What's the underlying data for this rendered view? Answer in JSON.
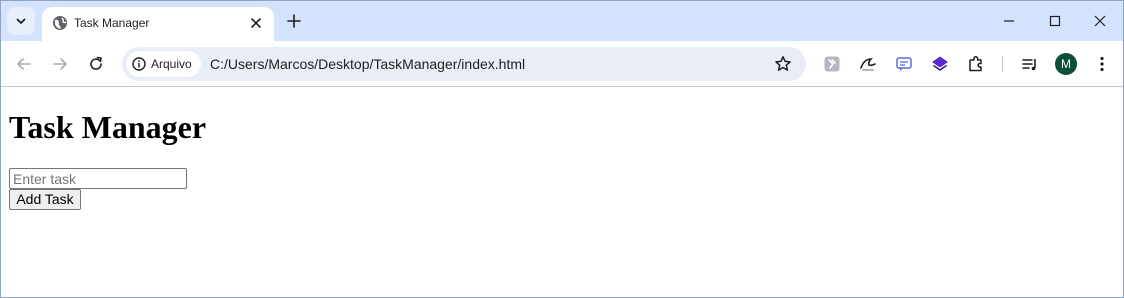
{
  "browser": {
    "tab": {
      "title": "Task Manager",
      "favicon": "globe-icon"
    },
    "address_bar": {
      "site_chip_label": "Arquivo",
      "url": "C:/Users/Marcos/Desktop/TaskManager/index.html"
    },
    "profile_initial": "M",
    "extensions": [
      "extension-gray-icon",
      "extension-wave-icon",
      "extension-chat-icon",
      "extension-layers-icon",
      "extensions-puzzle-icon"
    ]
  },
  "page": {
    "heading": "Task Manager",
    "task_input": {
      "value": "",
      "placeholder": "Enter task"
    },
    "add_button_label": "Add Task"
  },
  "colors": {
    "tabstrip": "#d3e3fd",
    "omnibox": "#e9eef6",
    "avatar": "#0b4f3b",
    "chat_extension": "#5b6bd6",
    "layers_extension": "#5a2bd0"
  }
}
